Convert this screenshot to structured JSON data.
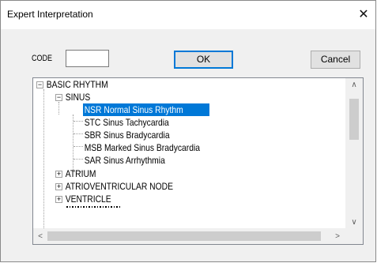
{
  "window": {
    "title": "Expert Interpretation",
    "close_glyph": "✕"
  },
  "form": {
    "code_label": "CODE",
    "code_value": "",
    "ok_label": "OK",
    "cancel_label": "Cancel"
  },
  "tree": {
    "nodes": [
      {
        "label": "BASIC RHYTHM",
        "expander": "−"
      },
      {
        "label": "SINUS",
        "expander": "−"
      },
      {
        "label": "NSR  Normal Sinus Rhythm",
        "selected": true
      },
      {
        "label": "STC  Sinus Tachycardia"
      },
      {
        "label": "SBR  Sinus Bradycardia"
      },
      {
        "label": "MSB  Marked Sinus Bradycardia"
      },
      {
        "label": "SAR  Sinus Arrhythmia"
      },
      {
        "label": "ATRIUM",
        "expander": "+"
      },
      {
        "label": "ATRIOVENTRICULAR NODE",
        "expander": "+"
      },
      {
        "label": "VENTRICLE",
        "expander": "+"
      }
    ],
    "colors": {
      "selection_bg": "#0078d7",
      "selection_text": "#ffffff"
    },
    "scroll": {
      "up_arrow": "∧",
      "down_arrow": "∨",
      "left_arrow": "<",
      "right_arrow": ">"
    }
  }
}
